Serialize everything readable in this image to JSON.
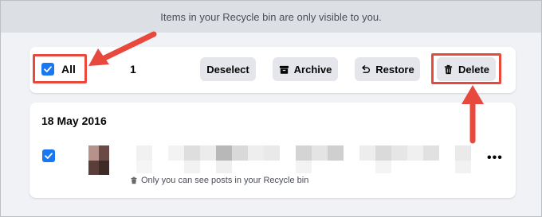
{
  "banner": {
    "text": "Items in your Recycle bin are only visible to you."
  },
  "toolbar": {
    "select_all_label": "All",
    "selected_count": "1",
    "deselect_label": "Deselect",
    "archive_label": "Archive",
    "restore_label": "Restore",
    "delete_label": "Delete"
  },
  "post": {
    "date": "18 May 2016",
    "caption": "Only you can see posts in your Recycle bin",
    "more_icon": "more-options-icon"
  },
  "colors": {
    "accent": "#1877f2",
    "highlight": "#e8493d",
    "button_bg": "#e4e6eb",
    "banner_bg": "#dcdfe3",
    "page_bg": "#f0f2f5"
  }
}
